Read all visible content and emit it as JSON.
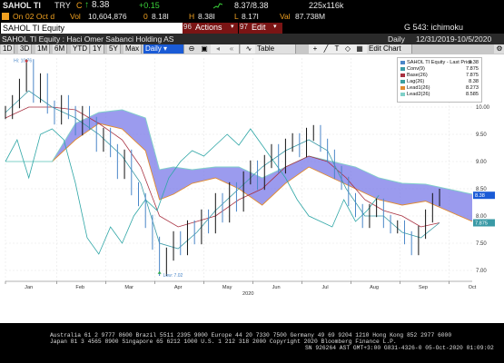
{
  "header": {
    "ticker": "SAHOL TI",
    "currency": "TRY",
    "last_flag": "C",
    "last_price": "8.38",
    "change": "+0.15",
    "bid_ask": "8.37/8.38",
    "size": "225x116k",
    "on_label": "On",
    "date": "02 Oct d",
    "vol_label": "Vol",
    "volume": "10,604,876",
    "open_label": "0",
    "open_value": "8.18I",
    "high_label": "H",
    "high_value": "8.38I",
    "low_label": "L",
    "low_value": "8.17I",
    "val_label": "Val",
    "val_value": "87.738M"
  },
  "command_row": {
    "security_field": "SAHOL TI Equity",
    "actions_num": "96",
    "actions_label": "Actions",
    "edit_num": "97",
    "edit_label": "Edit",
    "function_label": "G 543: ichimoku"
  },
  "subheader": {
    "security_name": "SAHOL TI Equity : Haci Omer Sabanci Holding AS",
    "frequency": "Daily",
    "date_range": "12/31/2019-10/5/2020"
  },
  "toolbar": {
    "periods": [
      "1D",
      "3D",
      "1M",
      "6M",
      "YTD",
      "1Y",
      "5Y",
      "Max"
    ],
    "frequency_select": "Daily",
    "table_label": "Table",
    "edit_chart_label": "Edit Chart"
  },
  "chart_data": {
    "type": "line",
    "title": "",
    "x_axis_month_labels": [
      "Jan",
      "Feb",
      "Mar",
      "Apr",
      "May",
      "Jun",
      "Jul",
      "Aug",
      "Sep",
      "Oct"
    ],
    "x_axis_year_label": "2020",
    "y_axis_tick_labels": [
      "10.00",
      "9.50",
      "9.00",
      "8.50",
      "8.00",
      "7.50",
      "7.00"
    ],
    "ylim": [
      6.8,
      10.9
    ],
    "legend_entries": [
      {
        "name": "SAHOL TI Equity - Last Price",
        "value": "8.38",
        "color": "#4a86c8"
      },
      {
        "name": "Conv(9)",
        "value": "7.875",
        "color": "#3a9aa6"
      },
      {
        "name": "Base(26)",
        "value": "7.875",
        "color": "#a83040"
      },
      {
        "name": "Lag(26)",
        "value": "8.38",
        "color": "#3aa0a0"
      },
      {
        "name": "Lead1(26)",
        "value": "8.273",
        "color": "#e08a30"
      },
      {
        "name": "Lead2(26)",
        "value": "8.585",
        "color": "#7fd0c8"
      }
    ],
    "annotations": {
      "high_label": "Hi: 10.76",
      "low_label": "Low: 7.02"
    },
    "right_axis_tags": [
      {
        "value": "8.38",
        "color": "#1a5bd6"
      },
      {
        "value": "7.875",
        "color": "#3a9aa6"
      }
    ],
    "price_path": [
      [
        0,
        9.9
      ],
      [
        3,
        10.1
      ],
      [
        6,
        10.4
      ],
      [
        9,
        10.76
      ],
      [
        12,
        10.2
      ],
      [
        15,
        10.5
      ],
      [
        18,
        10.0
      ],
      [
        21,
        9.8
      ],
      [
        24,
        10.1
      ],
      [
        27,
        9.9
      ],
      [
        30,
        9.6
      ],
      [
        33,
        9.9
      ],
      [
        36,
        9.7
      ],
      [
        39,
        9.3
      ],
      [
        42,
        9.5
      ],
      [
        45,
        9.2
      ],
      [
        48,
        8.8
      ],
      [
        51,
        9.1
      ],
      [
        54,
        8.5
      ],
      [
        57,
        8.3
      ],
      [
        60,
        7.9
      ],
      [
        63,
        7.5
      ],
      [
        66,
        7.02
      ],
      [
        69,
        7.3
      ],
      [
        72,
        7.6
      ],
      [
        75,
        7.4
      ],
      [
        78,
        7.8
      ],
      [
        81,
        7.6
      ],
      [
        84,
        8.0
      ],
      [
        87,
        7.8
      ],
      [
        90,
        8.3
      ],
      [
        93,
        8.0
      ],
      [
        96,
        8.5
      ],
      [
        99,
        8.2
      ],
      [
        102,
        8.7
      ],
      [
        105,
        8.9
      ],
      [
        108,
        8.6
      ],
      [
        111,
        9.0
      ],
      [
        114,
        9.2
      ],
      [
        117,
        8.9
      ],
      [
        120,
        9.3
      ],
      [
        123,
        9.4
      ],
      [
        126,
        9.2
      ],
      [
        129,
        9.5
      ],
      [
        132,
        9.55
      ],
      [
        135,
        9.3
      ],
      [
        138,
        9.1
      ],
      [
        141,
        8.8
      ],
      [
        144,
        8.6
      ],
      [
        147,
        8.3
      ],
      [
        150,
        8.1
      ],
      [
        153,
        7.9
      ],
      [
        156,
        8.1
      ],
      [
        159,
        8.2
      ],
      [
        162,
        7.9
      ],
      [
        165,
        7.8
      ],
      [
        168,
        7.8
      ],
      [
        171,
        7.6
      ],
      [
        174,
        7.4
      ],
      [
        177,
        7.7
      ],
      [
        180,
        8.0
      ],
      [
        183,
        8.3
      ],
      [
        186,
        8.38
      ]
    ],
    "conv_path": [
      [
        0,
        9.9
      ],
      [
        10,
        10.3
      ],
      [
        20,
        10.0
      ],
      [
        30,
        9.8
      ],
      [
        40,
        9.5
      ],
      [
        50,
        9.1
      ],
      [
        58,
        8.6
      ],
      [
        66,
        7.5
      ],
      [
        74,
        7.4
      ],
      [
        82,
        7.7
      ],
      [
        90,
        8.1
      ],
      [
        100,
        8.5
      ],
      [
        110,
        8.9
      ],
      [
        120,
        9.2
      ],
      [
        130,
        9.4
      ],
      [
        138,
        9.2
      ],
      [
        146,
        8.5
      ],
      [
        154,
        8.0
      ],
      [
        162,
        8.0
      ],
      [
        170,
        7.7
      ],
      [
        178,
        7.6
      ],
      [
        186,
        7.875
      ]
    ],
    "base_path": [
      [
        0,
        9.8
      ],
      [
        10,
        10.0
      ],
      [
        20,
        10.0
      ],
      [
        30,
        9.95
      ],
      [
        40,
        9.7
      ],
      [
        50,
        9.4
      ],
      [
        58,
        8.9
      ],
      [
        66,
        8.0
      ],
      [
        74,
        7.8
      ],
      [
        82,
        7.9
      ],
      [
        90,
        8.0
      ],
      [
        100,
        8.3
      ],
      [
        110,
        8.5
      ],
      [
        120,
        8.9
      ],
      [
        130,
        9.1
      ],
      [
        138,
        9.0
      ],
      [
        146,
        8.7
      ],
      [
        154,
        8.3
      ],
      [
        162,
        8.1
      ],
      [
        170,
        8.0
      ],
      [
        178,
        7.8
      ],
      [
        186,
        7.875
      ]
    ],
    "lag_path": [
      [
        0,
        9.0
      ],
      [
        5,
        9.4
      ],
      [
        10,
        8.7
      ],
      [
        15,
        9.5
      ],
      [
        20,
        9.6
      ],
      [
        25,
        9.4
      ],
      [
        30,
        8.6
      ],
      [
        35,
        7.6
      ],
      [
        40,
        7.3
      ],
      [
        45,
        7.8
      ],
      [
        50,
        7.5
      ],
      [
        55,
        8.0
      ],
      [
        60,
        8.3
      ],
      [
        65,
        8.1
      ],
      [
        70,
        8.7
      ],
      [
        75,
        9.0
      ],
      [
        80,
        9.2
      ],
      [
        85,
        9.1
      ],
      [
        90,
        9.3
      ],
      [
        95,
        9.5
      ],
      [
        100,
        9.3
      ],
      [
        105,
        9.6
      ],
      [
        110,
        9.3
      ],
      [
        115,
        9.0
      ],
      [
        120,
        8.7
      ],
      [
        125,
        8.3
      ],
      [
        130,
        8.0
      ],
      [
        135,
        7.9
      ],
      [
        140,
        7.8
      ],
      [
        145,
        8.3
      ],
      [
        150,
        7.9
      ],
      [
        155,
        8.1
      ],
      [
        160,
        8.38
      ]
    ],
    "lead1_path": [
      [
        0,
        9.0
      ],
      [
        20,
        9.0
      ],
      [
        30,
        9.4
      ],
      [
        40,
        9.7
      ],
      [
        50,
        9.6
      ],
      [
        60,
        9.2
      ],
      [
        66,
        8.3
      ],
      [
        72,
        8.4
      ],
      [
        80,
        8.6
      ],
      [
        90,
        8.7
      ],
      [
        100,
        8.5
      ],
      [
        110,
        8.2
      ],
      [
        120,
        8.6
      ],
      [
        130,
        8.9
      ],
      [
        140,
        8.7
      ],
      [
        150,
        8.5
      ],
      [
        160,
        8.3
      ],
      [
        170,
        8.2
      ],
      [
        180,
        8.273
      ],
      [
        200,
        7.9
      ]
    ],
    "lead2_path": [
      [
        0,
        9.0
      ],
      [
        20,
        9.0
      ],
      [
        30,
        9.7
      ],
      [
        40,
        9.9
      ],
      [
        50,
        9.95
      ],
      [
        60,
        9.8
      ],
      [
        66,
        8.85
      ],
      [
        72,
        8.9
      ],
      [
        80,
        8.85
      ],
      [
        90,
        8.9
      ],
      [
        100,
        8.9
      ],
      [
        110,
        8.7
      ],
      [
        120,
        8.9
      ],
      [
        130,
        9.1
      ],
      [
        140,
        9.0
      ],
      [
        150,
        8.9
      ],
      [
        160,
        8.7
      ],
      [
        170,
        8.6
      ],
      [
        180,
        8.585
      ],
      [
        200,
        8.4
      ]
    ]
  },
  "footer": {
    "line1": "Australia 61 2 9777 8600  Brazil 5511 2395 9000  Europe 44 20 7330 7500  Germany 49 69 9204 1210  Hong Kong 852 2977 6000",
    "line2": "Japan 81 3 4565 8900       Singapore 65 6212 1000        U.S. 1 212 318 2000         Copyright 2020 Bloomberg Finance L.P.",
    "line3": "SN 926264 AST  GMT+3:00 G831-4326-0 05-Oct-2020 01:09:02"
  }
}
